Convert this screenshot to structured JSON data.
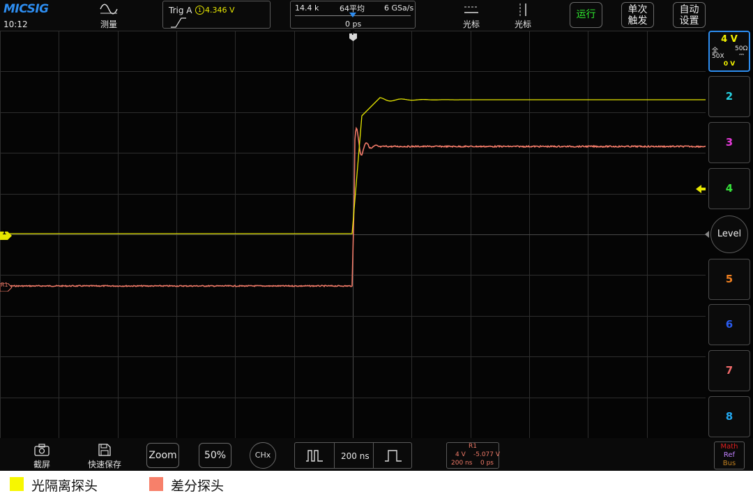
{
  "brand": "MICSIG",
  "clock": "10:12",
  "toolbar": {
    "measure_label": "测量",
    "trigger_label": "Trig A",
    "trigger_channel": "1",
    "trigger_level": "4.346 V",
    "memory_depth": "14.4 k",
    "acq_mode": "64平均",
    "sample_rate": "6 GSa/s",
    "time_offset": "0 ps",
    "cursor_h_label": "光标",
    "cursor_v_label": "光标",
    "run_label": "运行",
    "single_label_1": "单次",
    "single_label_2": "触发",
    "auto_label_1": "自动",
    "auto_label_2": "设置"
  },
  "channels": {
    "ch1": {
      "scale": "4 V",
      "coupling": "全",
      "impedance": "50Ω",
      "probe": "50X",
      "offset": "0 V",
      "color": "#f4f400"
    },
    "ch2": {
      "label": "2",
      "color": "#26d0e0"
    },
    "ch3": {
      "label": "3",
      "color": "#e23ad6"
    },
    "ch4": {
      "label": "4",
      "color": "#36e23a"
    },
    "level_label": "Level",
    "ch5": {
      "label": "5",
      "color": "#f08020"
    },
    "ch6": {
      "label": "6",
      "color": "#2a5cf0"
    },
    "ch7": {
      "label": "7",
      "color": "#f06a6a"
    },
    "ch8": {
      "label": "8",
      "color": "#22a8f0"
    }
  },
  "markers": {
    "ch1": "1",
    "ref": "R1",
    "trigger": "T"
  },
  "bottom": {
    "screenshot_label": "截屏",
    "quicksave_label": "快速保存",
    "zoom_label": "Zoom",
    "percent_label": "50%",
    "chx_label": "CHx",
    "timebase": "200 ns",
    "ref_title": "R1",
    "ref_volts": "4 V",
    "ref_offset": "-5.077 V",
    "ref_time": "200 ns",
    "ref_delay": "0 ps",
    "math_label": "Math",
    "ref_label": "Ref",
    "bus_label": "Bus"
  },
  "legend": [
    {
      "label": "光隔离探头",
      "color": "#f7f700"
    },
    {
      "label": "差分探头",
      "color": "#f7806a"
    }
  ],
  "colors": {
    "ch1": "#e8e800",
    "ref": "#f07a68",
    "grid": "#333333",
    "background": "#050505"
  }
}
